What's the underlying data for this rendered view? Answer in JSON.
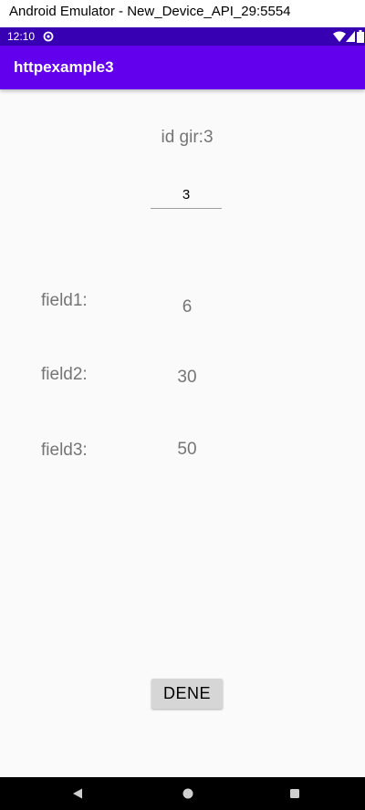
{
  "window": {
    "title": "Android Emulator - New_Device_API_29:5554"
  },
  "status_bar": {
    "time": "12:10",
    "icons": [
      "sync-icon",
      "wifi-icon",
      "signal-icon",
      "battery-icon"
    ],
    "color": "#3700b3"
  },
  "app_bar": {
    "title": "httpexample3",
    "color": "#6200ee"
  },
  "main": {
    "id_prompt": "id gir:3",
    "id_input": {
      "value": "3",
      "placeholder": ""
    },
    "fields": [
      {
        "label": "field1:",
        "value": "6"
      },
      {
        "label": "field2:",
        "value": "30"
      },
      {
        "label": "field3:",
        "value": "50"
      }
    ],
    "button_label": "DENE"
  },
  "nav_bar": {
    "icons": [
      "back-icon",
      "home-icon",
      "recents-icon"
    ]
  }
}
